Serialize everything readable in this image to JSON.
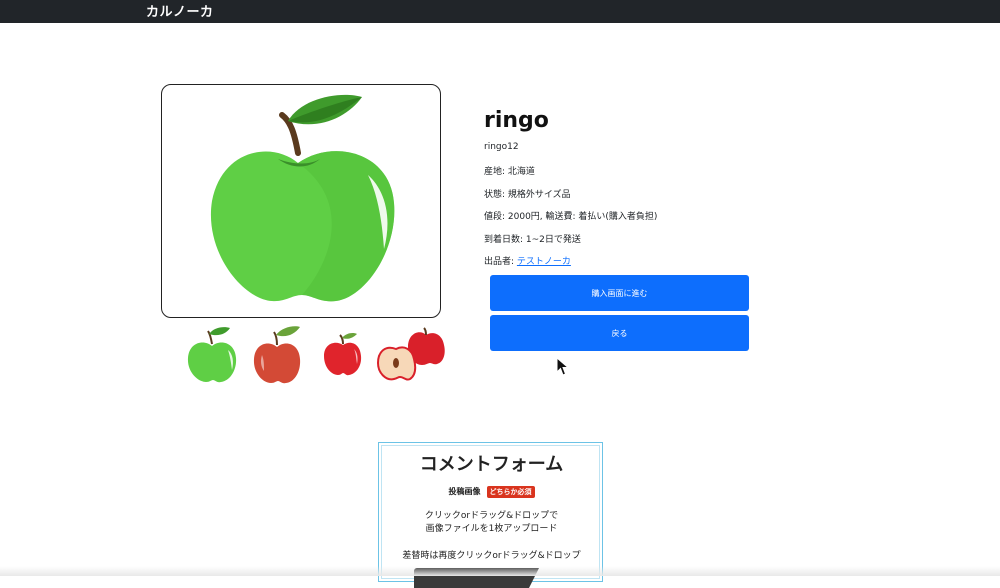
{
  "navbar": {
    "brand": "カルノーカ"
  },
  "product": {
    "name": "ringo",
    "id_label": "ringo12",
    "origin": "産地: 北海道",
    "condition": "状態: 規格外サイズ品",
    "price": "値段: 2000円, 輸送費: 着払い(購入者負担)",
    "delivery": "到着日数: 1~2日で発送",
    "seller_prefix": "出品者: ",
    "seller_name": "テストノーカ"
  },
  "actions": {
    "purchase_label": "購入画面に進む",
    "back_label": "戻る"
  },
  "comment_form": {
    "title": "コメントフォーム",
    "image_label": "投稿画像",
    "required_badge": "どちらか必須",
    "upload_line1": "クリックorドラッグ&ドロップで",
    "upload_line2": "画像ファイルを1枚アップロード",
    "replace_note": "差替時は再度クリックorドラッグ&ドロップ"
  },
  "colors": {
    "navbar": "#212529",
    "primary": "#0d6efd",
    "badge": "#d9341e",
    "link": "#0d6efd"
  },
  "icons": [
    "green-apple-icon",
    "red-apple-icon",
    "apple-slice-icon",
    "mouse-cursor-icon"
  ]
}
